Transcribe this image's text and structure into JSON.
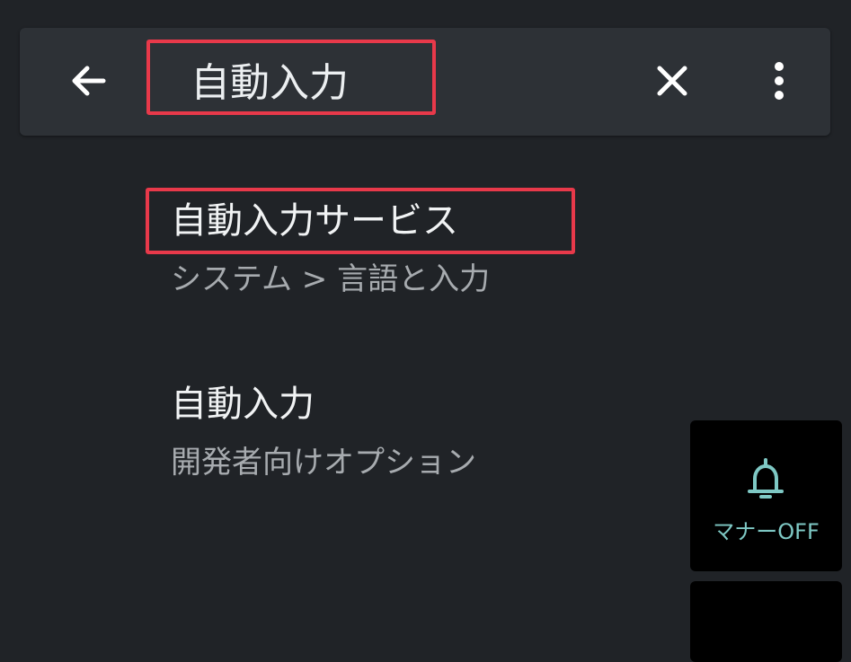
{
  "search": {
    "query": "自動入力",
    "back_icon": "arrow-left-icon",
    "clear_icon": "close-icon",
    "more_icon": "more-vertical-icon"
  },
  "results": [
    {
      "title": "自動入力サービス",
      "path": "システム > 言語と入力"
    },
    {
      "title": "自動入力",
      "path": "開発者向けオプション"
    }
  ],
  "quick_tile": {
    "label": "マナーOFF",
    "icon": "bell-icon",
    "accent_color": "#7ec8c4"
  },
  "highlight_color": "#e8394a"
}
